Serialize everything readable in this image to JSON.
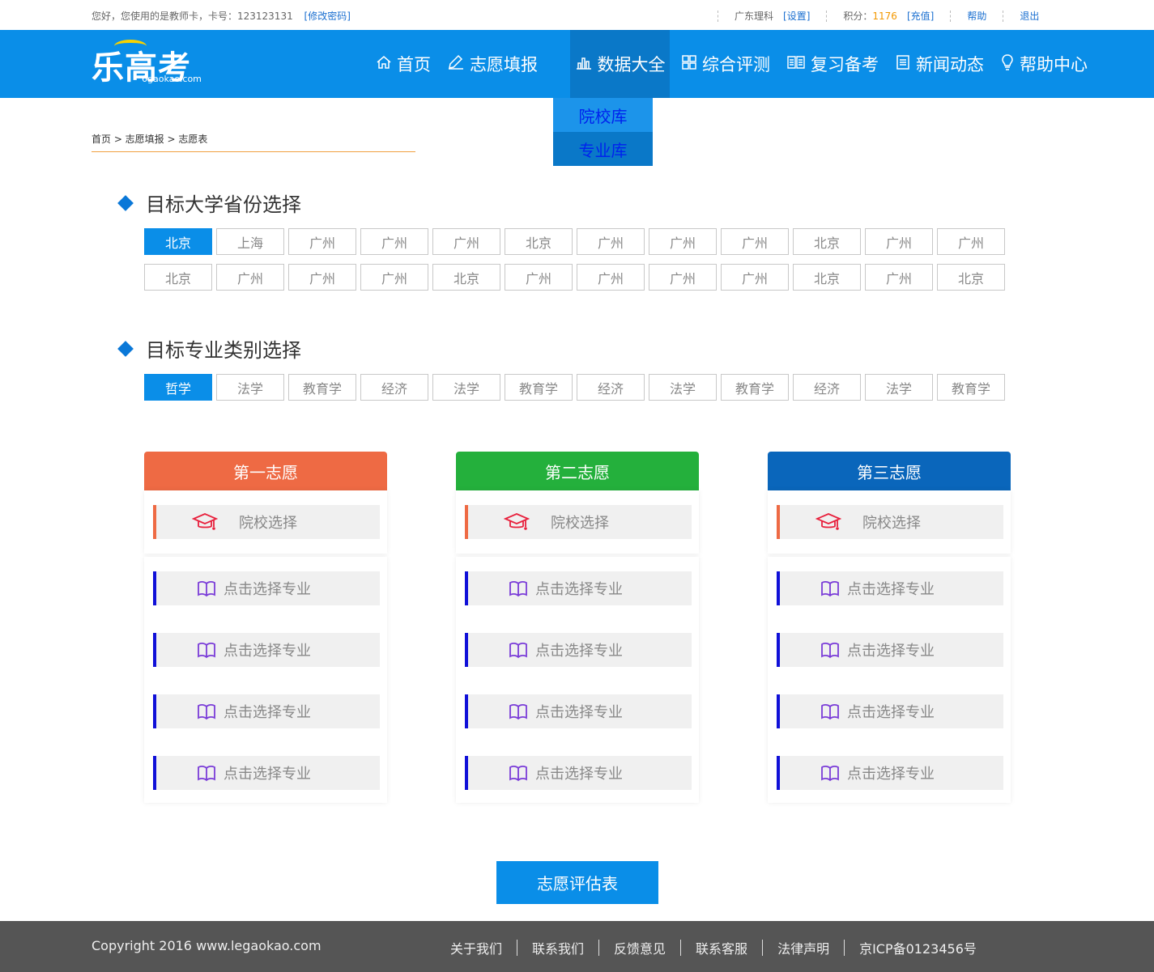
{
  "topbar": {
    "greeting": "您好，您使用的是教师卡，卡号：123123131",
    "change_password": "[修改密码]",
    "region": "广东理科",
    "settings": "[设置]",
    "points_label": "积分：",
    "points_value": "1176",
    "recharge": "[充值]",
    "help": "帮助",
    "logout": "退出"
  },
  "logo": {
    "main": "乐高考",
    "sub": "6gaokao.com"
  },
  "nav": {
    "items": [
      {
        "label": "首页",
        "icon": "home-icon"
      },
      {
        "label": "志愿填报",
        "icon": "pen-icon"
      },
      {
        "label": "数据大全",
        "icon": "bar-chart-icon"
      },
      {
        "label": "综合评测",
        "icon": "grid-icon"
      },
      {
        "label": "复习备考",
        "icon": "book-open-icon"
      },
      {
        "label": "新闻动态",
        "icon": "document-icon"
      },
      {
        "label": "帮助中心",
        "icon": "lightbulb-icon"
      }
    ],
    "dropdown": [
      "院校库",
      "专业库"
    ]
  },
  "breadcrumb": "首页 > 志愿填报 > 志愿表",
  "province_section": {
    "title": "目标大学省份选择",
    "options": [
      "北京",
      "上海",
      "广州",
      "广州",
      "广州",
      "北京",
      "广州",
      "广州",
      "广州",
      "北京",
      "广州",
      "广州",
      "北京",
      "广州",
      "广州",
      "广州",
      "北京",
      "广州",
      "广州",
      "广州",
      "广州",
      "北京",
      "广州",
      "北京"
    ]
  },
  "major_section": {
    "title": "目标专业类别选择",
    "options": [
      "哲学",
      "法学",
      "教育学",
      "经济",
      "法学",
      "教育学",
      "经济",
      "法学",
      "教育学",
      "经济",
      "法学",
      "教育学"
    ]
  },
  "cards": [
    {
      "title": "第一志愿",
      "color": "#ee6a44",
      "school": "院校选择",
      "majors": [
        "点击选择专业",
        "点击选择专业",
        "点击选择专业",
        "点击选择专业"
      ]
    },
    {
      "title": "第二志愿",
      "color": "#24b03c",
      "school": "院校选择",
      "majors": [
        "点击选择专业",
        "点击选择专业",
        "点击选择专业",
        "点击选择专业"
      ]
    },
    {
      "title": "第三志愿",
      "color": "#0a66bb",
      "school": "院校选择",
      "majors": [
        "点击选择专业",
        "点击选择专业",
        "点击选择专业",
        "点击选择专业"
      ]
    }
  ],
  "eval_button": "志愿评估表",
  "footer": {
    "copyright": "Copyright 2016 www.legaokao.com",
    "links": [
      "关于我们",
      "联系我们",
      "反馈意见",
      "联系客服",
      "法律声明",
      "京ICP备0123456号"
    ]
  }
}
